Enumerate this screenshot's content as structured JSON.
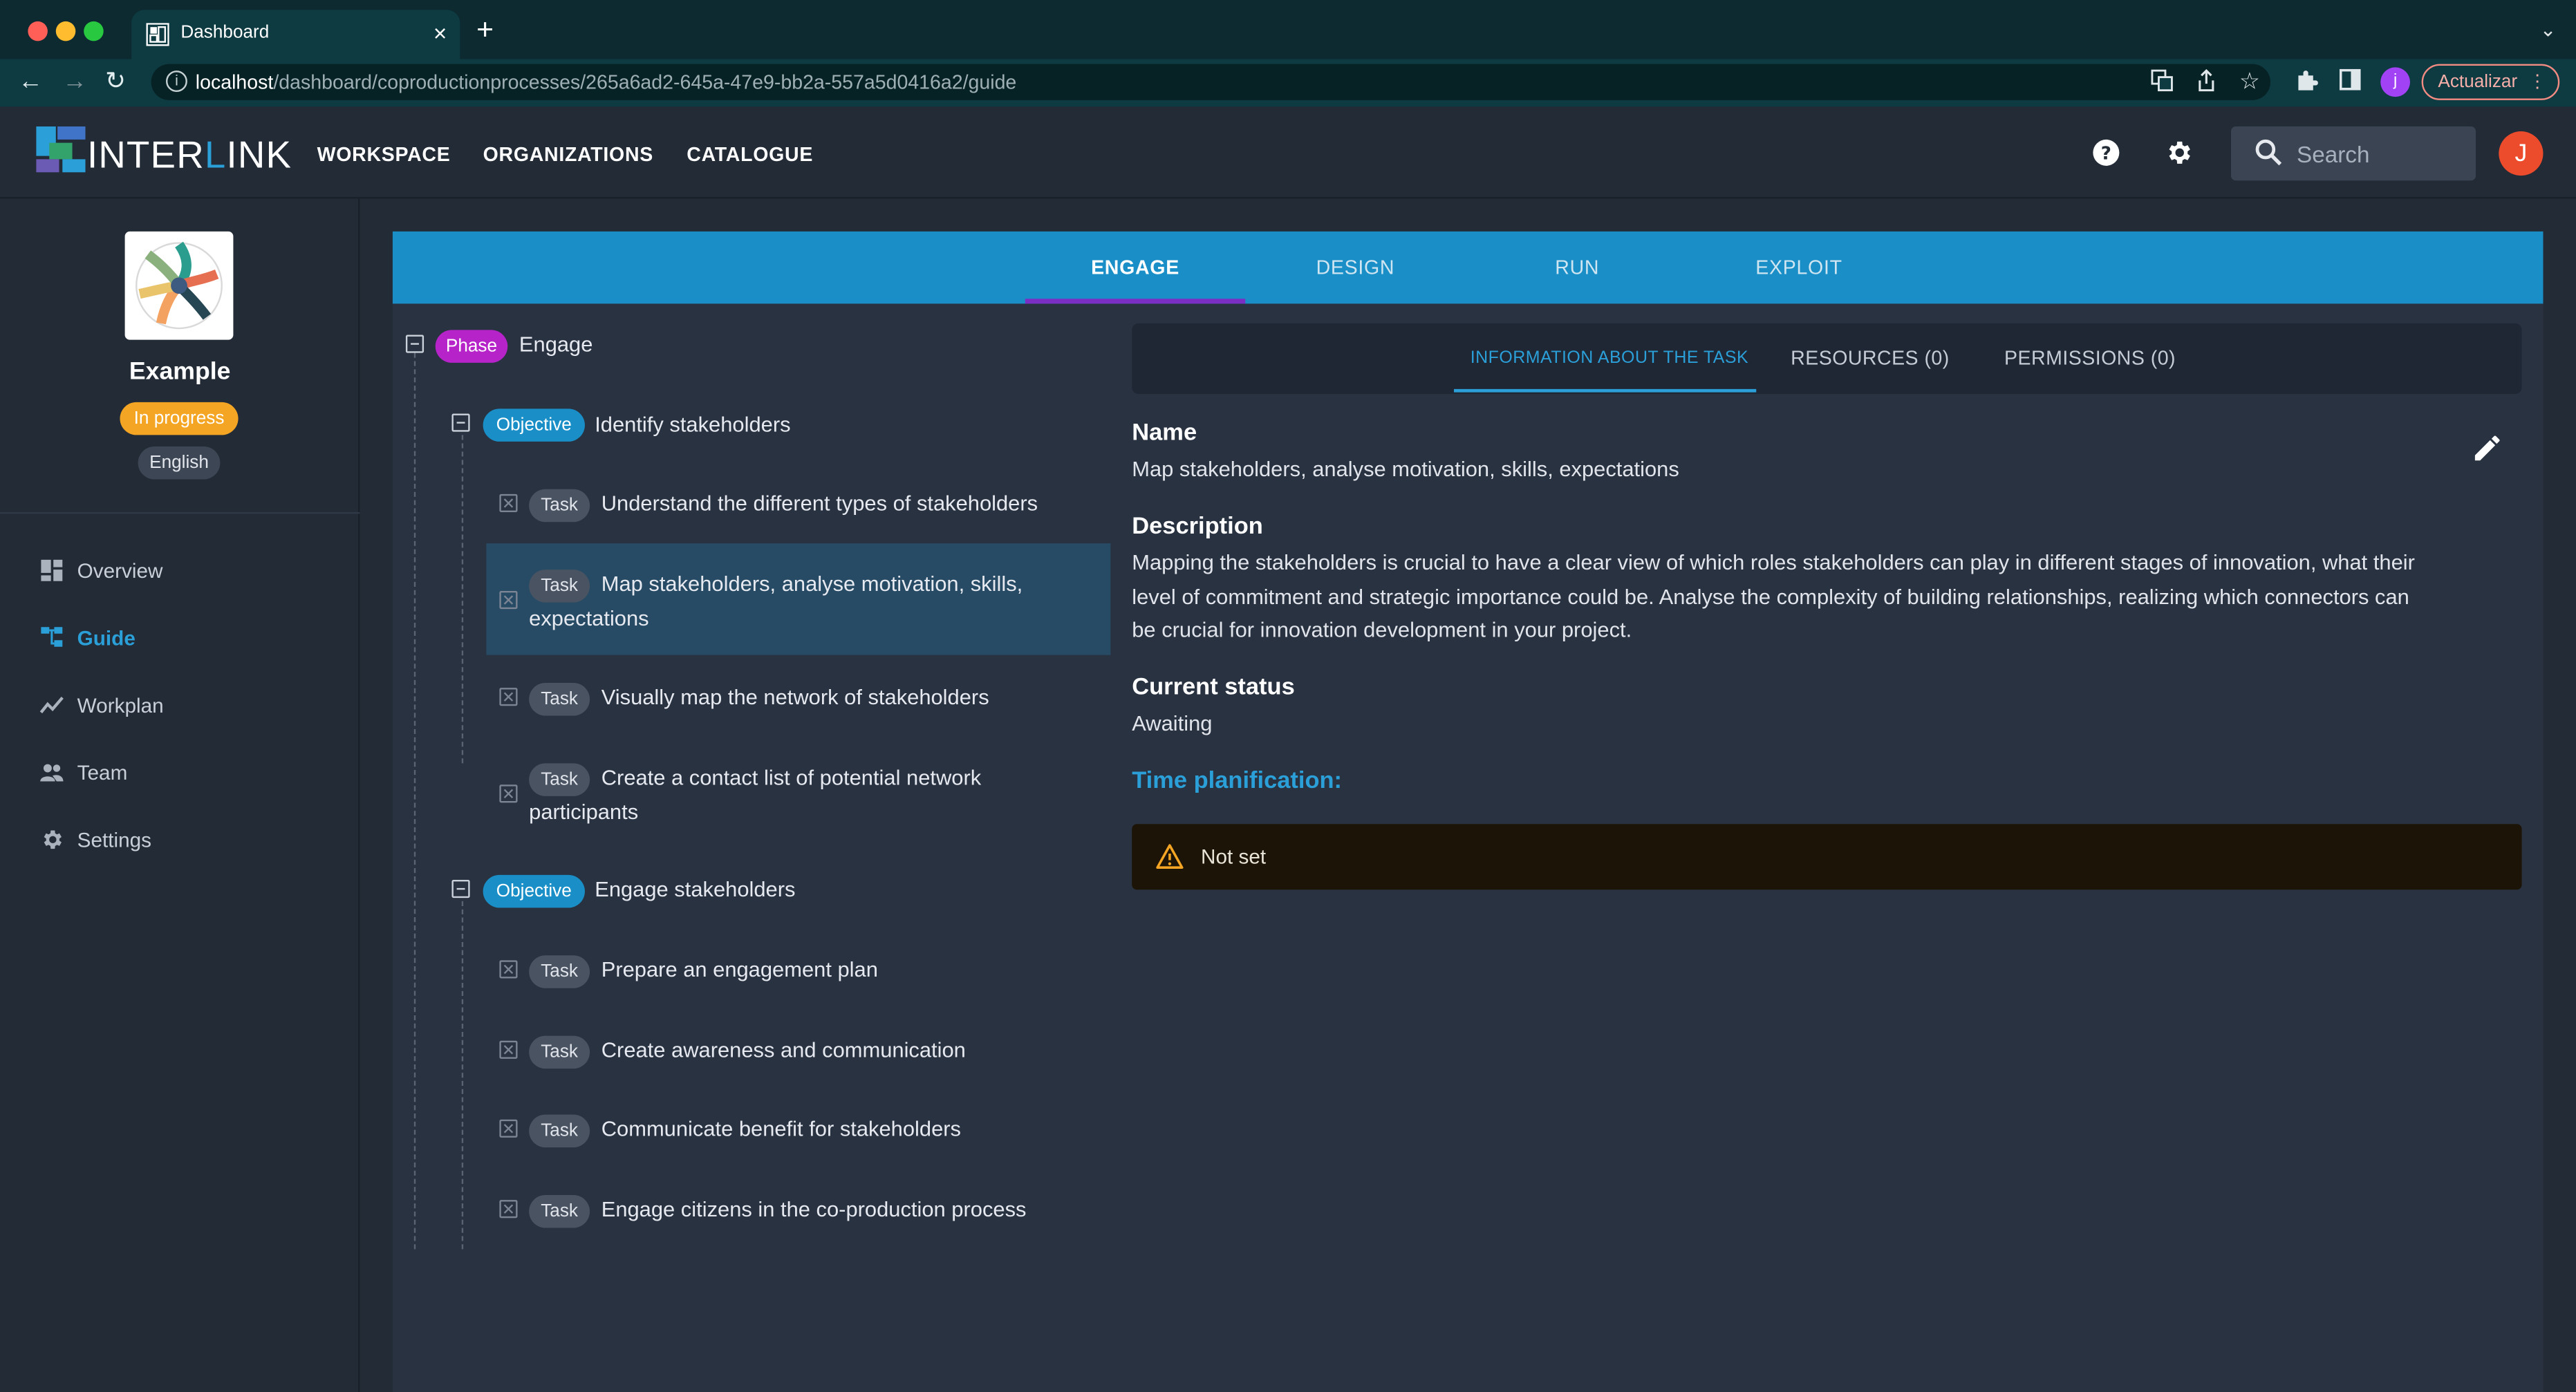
{
  "browser": {
    "tab_title": "Dashboard",
    "tab_close": "×",
    "new_tab": "+",
    "url_host": "localhost",
    "url_path": "/dashboard/coproductionprocesses/265a6ad2-645a-47e9-bb2a-557a5d0416a2/guide",
    "profile_initial": "j",
    "update_label": "Actualizar",
    "more_glyph": "⋮"
  },
  "header": {
    "logo_prefix": "INTER",
    "logo_accent": "L",
    "logo_suffix": "INK",
    "nav": [
      "WORKSPACE",
      "ORGANIZATIONS",
      "CATALOGUE"
    ],
    "search_placeholder": "Search",
    "avatar_initial": "J"
  },
  "sidebar": {
    "project_name": "Example",
    "status": "In progress",
    "language": "English",
    "items": [
      {
        "label": "Overview",
        "icon": "dashboard-icon",
        "active": false
      },
      {
        "label": "Guide",
        "icon": "tree-icon",
        "active": true
      },
      {
        "label": "Workplan",
        "icon": "timeline-icon",
        "active": false
      },
      {
        "label": "Team",
        "icon": "people-icon",
        "active": false
      },
      {
        "label": "Settings",
        "icon": "gear-icon",
        "active": false
      }
    ]
  },
  "phases": {
    "tabs": [
      "ENGAGE",
      "DESIGN",
      "RUN",
      "EXPLOIT"
    ],
    "active": "ENGAGE"
  },
  "tree": {
    "phase": {
      "chip": "Phase",
      "label": "Engage"
    },
    "objectives": [
      {
        "chip": "Objective",
        "label": "Identify stakeholders",
        "tasks": [
          {
            "chip": "Task",
            "label_1": "Understand the different types of stakeholders",
            "label_2": ""
          },
          {
            "chip": "Task",
            "label_1": "Map stakeholders, analyse motivation, skills,",
            "label_2": "expectations",
            "selected": true
          },
          {
            "chip": "Task",
            "label_1": "Visually map the network of stakeholders",
            "label_2": ""
          },
          {
            "chip": "Task",
            "label_1": "Create a contact list of potential network",
            "label_2": "participants"
          }
        ]
      },
      {
        "chip": "Objective",
        "label": "Engage stakeholders",
        "tasks": [
          {
            "chip": "Task",
            "label_1": "Prepare an engagement plan",
            "label_2": ""
          },
          {
            "chip": "Task",
            "label_1": "Create awareness and communication",
            "label_2": ""
          },
          {
            "chip": "Task",
            "label_1": "Communicate benefit for stakeholders",
            "label_2": ""
          },
          {
            "chip": "Task",
            "label_1": "Engage citizens in the co-production process",
            "label_2": ""
          }
        ]
      }
    ]
  },
  "detail": {
    "tabs": [
      "INFORMATION ABOUT THE TASK",
      "RESOURCES (0)",
      "PERMISSIONS (0)"
    ],
    "name_title": "Name",
    "name_value": "Map stakeholders, analyse motivation, skills, expectations",
    "description_title": "Description",
    "description_lines": [
      "Mapping the stakeholders is crucial to have a clear view of which roles stakeholders can play in different stages of innovation, what their",
      "level of commitment and strategic importance could be. Analyse the complexity of building relationships, realizing which connectors can",
      "be crucial for innovation development in your project."
    ],
    "status_title": "Current status",
    "status_value": "Awaiting",
    "time_title": "Time planification:",
    "time_value": "Not set"
  },
  "colors": {
    "accent": "#1a8fc7",
    "phase_chip": "#b523c9",
    "status_badge": "#f5a524",
    "avatar": "#ed4c2c"
  }
}
